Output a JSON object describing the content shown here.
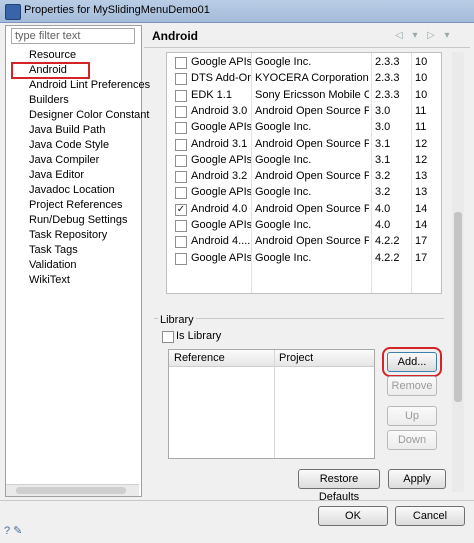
{
  "window": {
    "title": "Properties for MySlidingMenuDemo01"
  },
  "left": {
    "filter_placeholder": "type filter text",
    "tree": [
      "Resource",
      "Android",
      "Android Lint Preferences",
      "Builders",
      "Designer Color Constant",
      "Java Build Path",
      "Java Code Style",
      "Java Compiler",
      "Java Editor",
      "Javadoc Location",
      "Project References",
      "Run/Debug Settings",
      "Task Repository",
      "Task Tags",
      "Validation",
      "WikiText"
    ],
    "selected": "Android"
  },
  "page": {
    "title": "Android"
  },
  "targets": [
    {
      "checked": false,
      "name": "Google APIs",
      "vendor": "Google Inc.",
      "platform": "2.3.3",
      "api": "10"
    },
    {
      "checked": false,
      "name": "DTS Add-On",
      "vendor": "KYOCERA Corporation",
      "platform": "2.3.3",
      "api": "10"
    },
    {
      "checked": false,
      "name": "EDK 1.1",
      "vendor": "Sony Ericsson Mobile C...",
      "platform": "2.3.3",
      "api": "10"
    },
    {
      "checked": false,
      "name": "Android 3.0",
      "vendor": "Android Open Source P...",
      "platform": "3.0",
      "api": "11"
    },
    {
      "checked": false,
      "name": "Google APIs",
      "vendor": "Google Inc.",
      "platform": "3.0",
      "api": "11"
    },
    {
      "checked": false,
      "name": "Android 3.1",
      "vendor": "Android Open Source P...",
      "platform": "3.1",
      "api": "12"
    },
    {
      "checked": false,
      "name": "Google APIs",
      "vendor": "Google Inc.",
      "platform": "3.1",
      "api": "12"
    },
    {
      "checked": false,
      "name": "Android 3.2",
      "vendor": "Android Open Source P...",
      "platform": "3.2",
      "api": "13"
    },
    {
      "checked": false,
      "name": "Google APIs",
      "vendor": "Google Inc.",
      "platform": "3.2",
      "api": "13"
    },
    {
      "checked": true,
      "name": "Android 4.0",
      "vendor": "Android Open Source P...",
      "platform": "4.0",
      "api": "14"
    },
    {
      "checked": false,
      "name": "Google APIs",
      "vendor": "Google Inc.",
      "platform": "4.0",
      "api": "14"
    },
    {
      "checked": false,
      "name": "Android 4....",
      "vendor": "Android Open Source P...",
      "platform": "4.2.2",
      "api": "17"
    },
    {
      "checked": false,
      "name": "Google APIs",
      "vendor": "Google Inc.",
      "platform": "4.2.2",
      "api": "17"
    }
  ],
  "library": {
    "label": "Library",
    "is_library": "Is Library",
    "col_reference": "Reference",
    "col_project": "Project",
    "add": "Add...",
    "remove": "Remove",
    "up": "Up",
    "down": "Down"
  },
  "buttons": {
    "restore": "Restore Defaults",
    "apply": "Apply",
    "ok": "OK",
    "cancel": "Cancel"
  }
}
